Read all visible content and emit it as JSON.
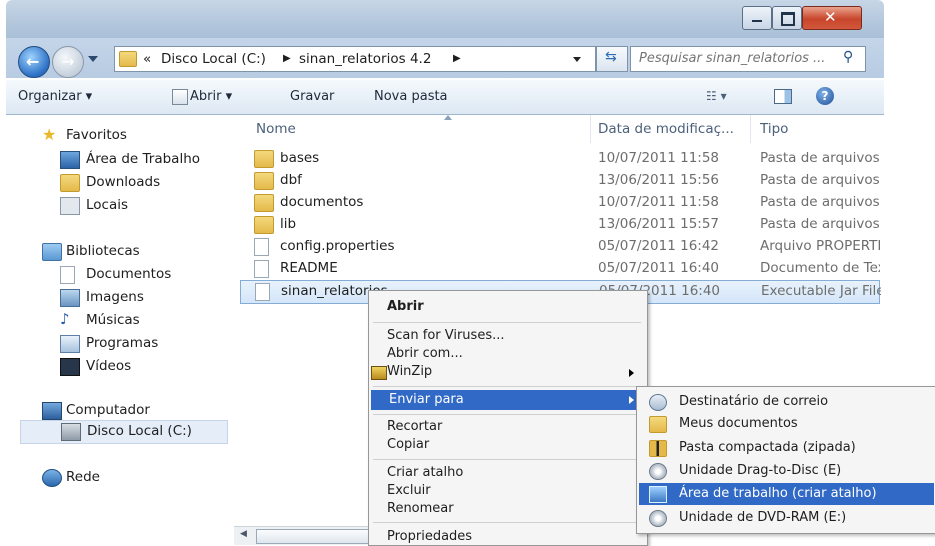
{
  "address": {
    "chevrons": "«",
    "crumbs": [
      "Disco Local (C:)",
      "sinan_relatorios 4.2"
    ],
    "search_placeholder": "Pesquisar sinan_relatorios ..."
  },
  "toolbar": {
    "organize": "Organizar ▾",
    "open": "Abrir ▾",
    "burn": "Gravar",
    "new_folder": "Nova pasta"
  },
  "nav": {
    "favorites": "Favoritos",
    "desktop": "Área de Trabalho",
    "downloads": "Downloads",
    "places": "Locais",
    "libraries": "Bibliotecas",
    "documents": "Documentos",
    "images": "Imagens",
    "music": "Músicas",
    "programs": "Programas",
    "videos": "Vídeos",
    "computer": "Computador",
    "local_disk": "Disco Local (C:)",
    "network": "Rede"
  },
  "columns": {
    "name": "Nome",
    "date": "Data de modificaç...",
    "type": "Tipo"
  },
  "files": [
    {
      "name": "bases",
      "date": "10/07/2011 11:58",
      "type": "Pasta de arquivos",
      "icon": "folder-icon"
    },
    {
      "name": "dbf",
      "date": "13/06/2011 15:56",
      "type": "Pasta de arquivos",
      "icon": "folder-icon"
    },
    {
      "name": "documentos",
      "date": "10/07/2011 11:58",
      "type": "Pasta de arquivos",
      "icon": "folder-icon"
    },
    {
      "name": "lib",
      "date": "13/06/2011 15:57",
      "type": "Pasta de arquivos",
      "icon": "folder-icon"
    },
    {
      "name": "config.properties",
      "date": "05/07/2011 16:42",
      "type": "Arquivo PROPERTIES",
      "icon": "file-icon"
    },
    {
      "name": "README",
      "date": "05/07/2011 16:40",
      "type": "Documento de Texto",
      "icon": "file-icon"
    },
    {
      "name": "sinan_relatorios",
      "date": "05/07/2011 16:40",
      "type": "Executable Jar File",
      "icon": "jar-file-icon"
    }
  ],
  "context_menu": {
    "open": "Abrir",
    "scan": "Scan for Viruses...",
    "open_with": "Abrir com...",
    "winzip": "WinZip",
    "send_to": "Enviar para",
    "cut": "Recortar",
    "copy": "Copiar",
    "create_shortcut": "Criar atalho",
    "delete": "Excluir",
    "rename": "Renomear",
    "properties": "Propriedades"
  },
  "send_to_menu": {
    "mail": "Destinatário de correio",
    "my_docs": "Meus documentos",
    "zip": "Pasta compactada (zipada)",
    "drag_to_disc": "Unidade Drag-to-Disc (E)",
    "desktop_shortcut": "Área de trabalho (criar atalho)",
    "dvd_ram": "Unidade de DVD-RAM (E:)"
  },
  "colors": {
    "highlight": "#3169c6",
    "selection": "#d4e6f9",
    "folder": "#e4b94a"
  }
}
